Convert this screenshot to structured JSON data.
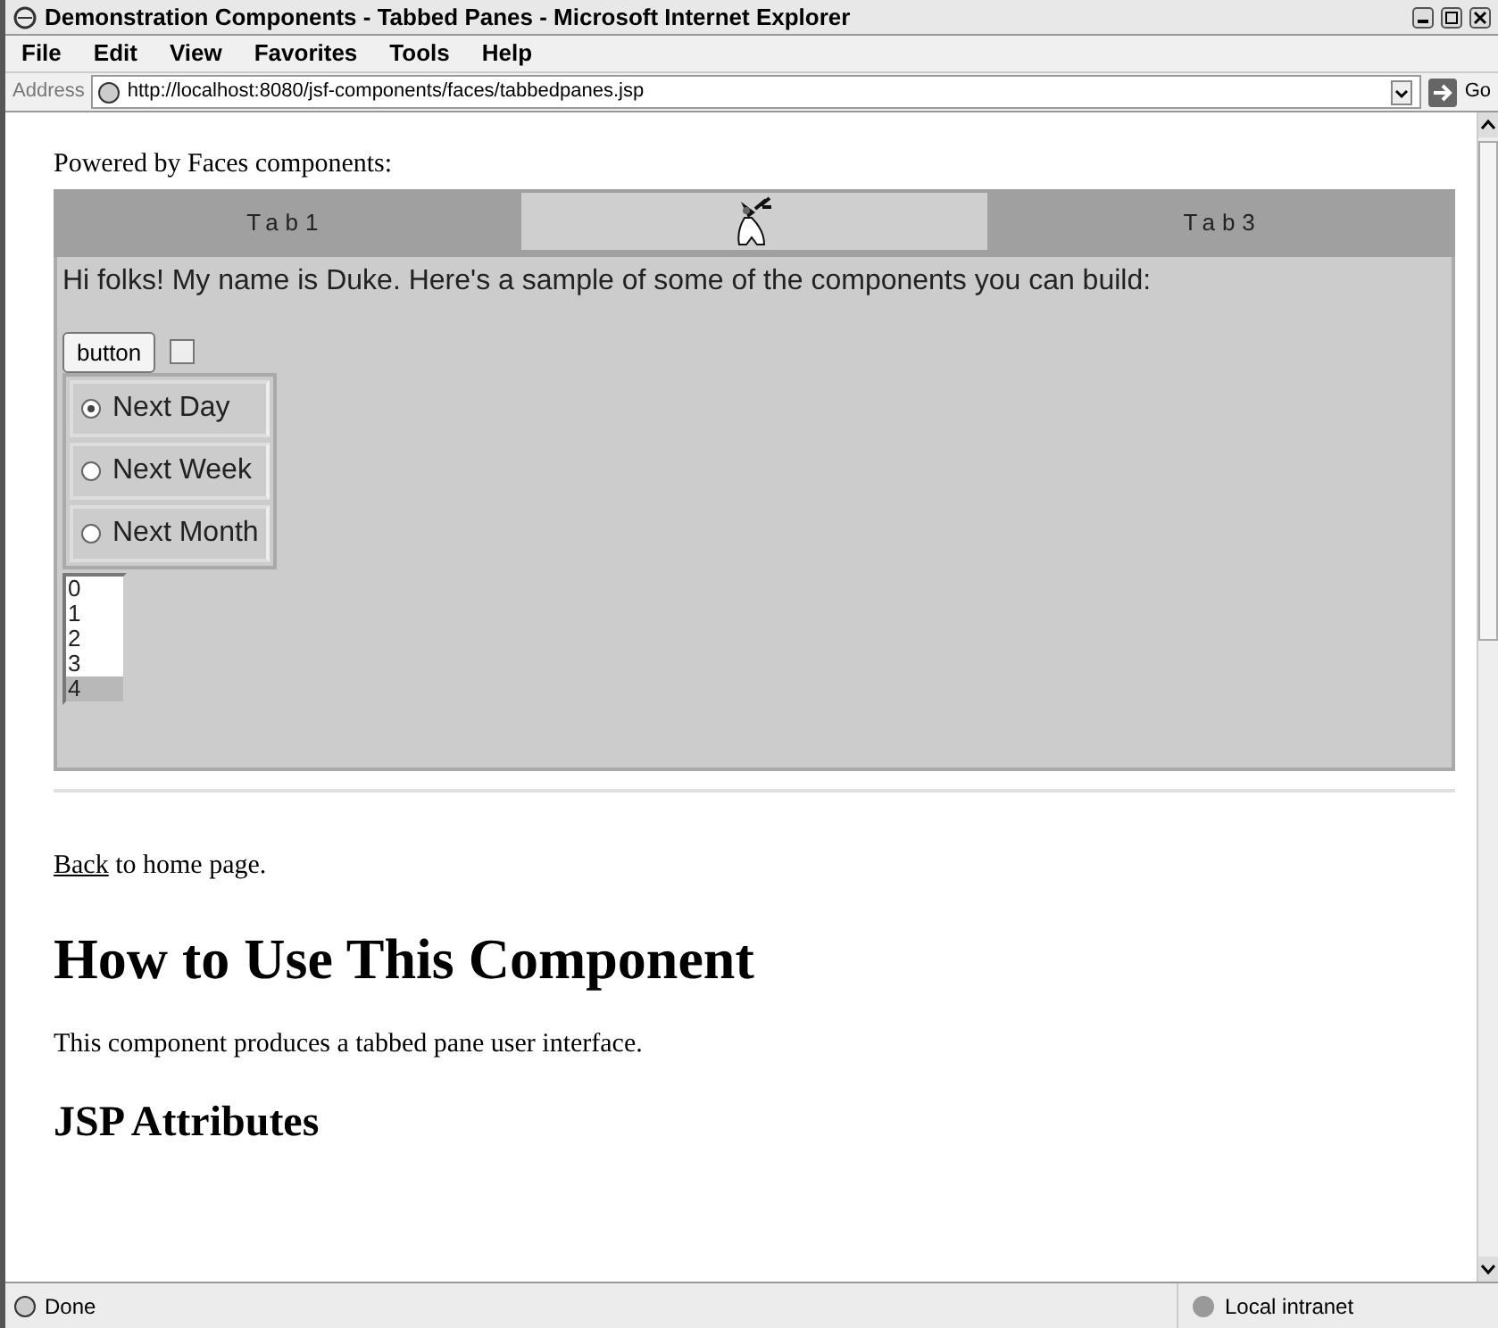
{
  "window": {
    "title": "Demonstration Components - Tabbed Panes - Microsoft Internet Explorer"
  },
  "menu": [
    "File",
    "Edit",
    "View",
    "Favorites",
    "Tools",
    "Help"
  ],
  "address_bar": {
    "label": "Address",
    "url": "http://localhost:8080/jsf-components/faces/tabbedpanes.jsp",
    "go": "Go"
  },
  "page": {
    "intro": "Powered by Faces components:",
    "tabs": [
      {
        "kind": "text",
        "label": "Tab1",
        "selected": false
      },
      {
        "kind": "icon",
        "selected": true
      },
      {
        "kind": "text",
        "label": "Tab3",
        "selected": false
      }
    ],
    "panel": {
      "greeting": "Hi folks! My name is Duke.  Here's a sample of some of the components you can build:",
      "button": "button",
      "checkbox": {
        "checked": false
      },
      "radios": [
        {
          "label": "Next Day",
          "selected": true
        },
        {
          "label": "Next Week",
          "selected": false
        },
        {
          "label": "Next Month",
          "selected": false
        }
      ],
      "listbox": [
        {
          "label": "0",
          "selected": false
        },
        {
          "label": "1",
          "selected": false
        },
        {
          "label": "2",
          "selected": false
        },
        {
          "label": "3",
          "selected": false
        },
        {
          "label": "4",
          "selected": true
        }
      ]
    },
    "back_link": "Back",
    "back_text": " to home page.",
    "heading": "How to Use This Component",
    "description": "This component produces a tabbed pane user interface.",
    "subheading": "JSP Attributes"
  },
  "status_bar": {
    "text": "Done",
    "zone": "Local intranet"
  }
}
